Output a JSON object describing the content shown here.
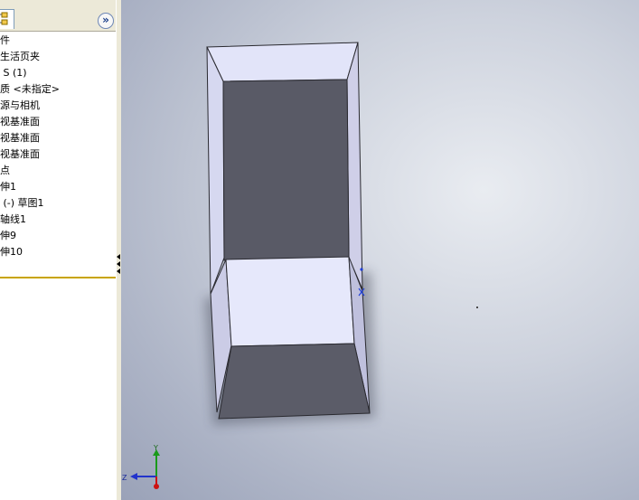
{
  "feature_tree": {
    "items": [
      "件",
      "生活页夹",
      " S (1)",
      "质 <未指定>",
      "源与相机",
      "视基准面",
      "视基准面",
      "视基准面",
      "点",
      "伸1",
      " (-) 草图1",
      "轴线1",
      "伸9",
      "伸10"
    ]
  },
  "toolbar": {
    "expand_icon": "double-chevron-right-icon",
    "tab_icon": "feature-manager-tree-icon"
  },
  "triad": {
    "y_label": "Y",
    "z_label": "Z",
    "colors": {
      "y": "#1a9a1a",
      "z": "#2233cc",
      "x": "#cc1111"
    }
  }
}
